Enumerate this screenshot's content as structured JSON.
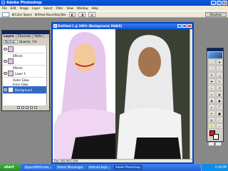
{
  "app": {
    "title": "Adobe Photoshop"
  },
  "window_controls": {
    "minimize": "_",
    "maximize": "□",
    "close": "x"
  },
  "menu": [
    "File",
    "Edit",
    "Image",
    "Layer",
    "Select",
    "Filter",
    "View",
    "Window",
    "Help"
  ],
  "options_bar": {
    "color_space": "Color Space",
    "show_bounding_box": "Show Bounding Box",
    "brushes_tab": "Brushes"
  },
  "layers_palette": {
    "tabs": [
      "Layers",
      "Channels",
      "Paths"
    ],
    "blend_mode": "Normal",
    "opacity_label": "Opacity:",
    "fill_label": "Fill:",
    "rows": [
      {
        "label": ""
      },
      {
        "label": "Effects",
        "sub": true
      },
      {
        "label": ""
      },
      {
        "label": "Effects",
        "sub": true
      },
      {
        "label": "Layer 1"
      },
      {
        "label": "Outer Glow",
        "sub": true
      },
      {
        "label": "Inner Glow",
        "sub": true
      },
      {
        "label": "Background",
        "active": true
      }
    ]
  },
  "document": {
    "title": "Untitled-1 @ 100% (Background, RGB/8)",
    "status": "Doc: 585.9K/2.32M"
  },
  "taskbar": {
    "start_label": "start",
    "tasks": [
      {
        "label": "Kaya+MAYA+blo..."
      },
      {
        "label": "Yahoo! Messenger"
      },
      {
        "label": "Internet Expl..."
      },
      {
        "label": "Adobe Photoshop",
        "active": true
      }
    ],
    "clock": "2:58 PM"
  },
  "colors": {
    "foreground": "#e8141c",
    "background": "#ffffff",
    "canvas_left_bg": "#ffffff",
    "canvas_right_bg": "#3a4034"
  }
}
